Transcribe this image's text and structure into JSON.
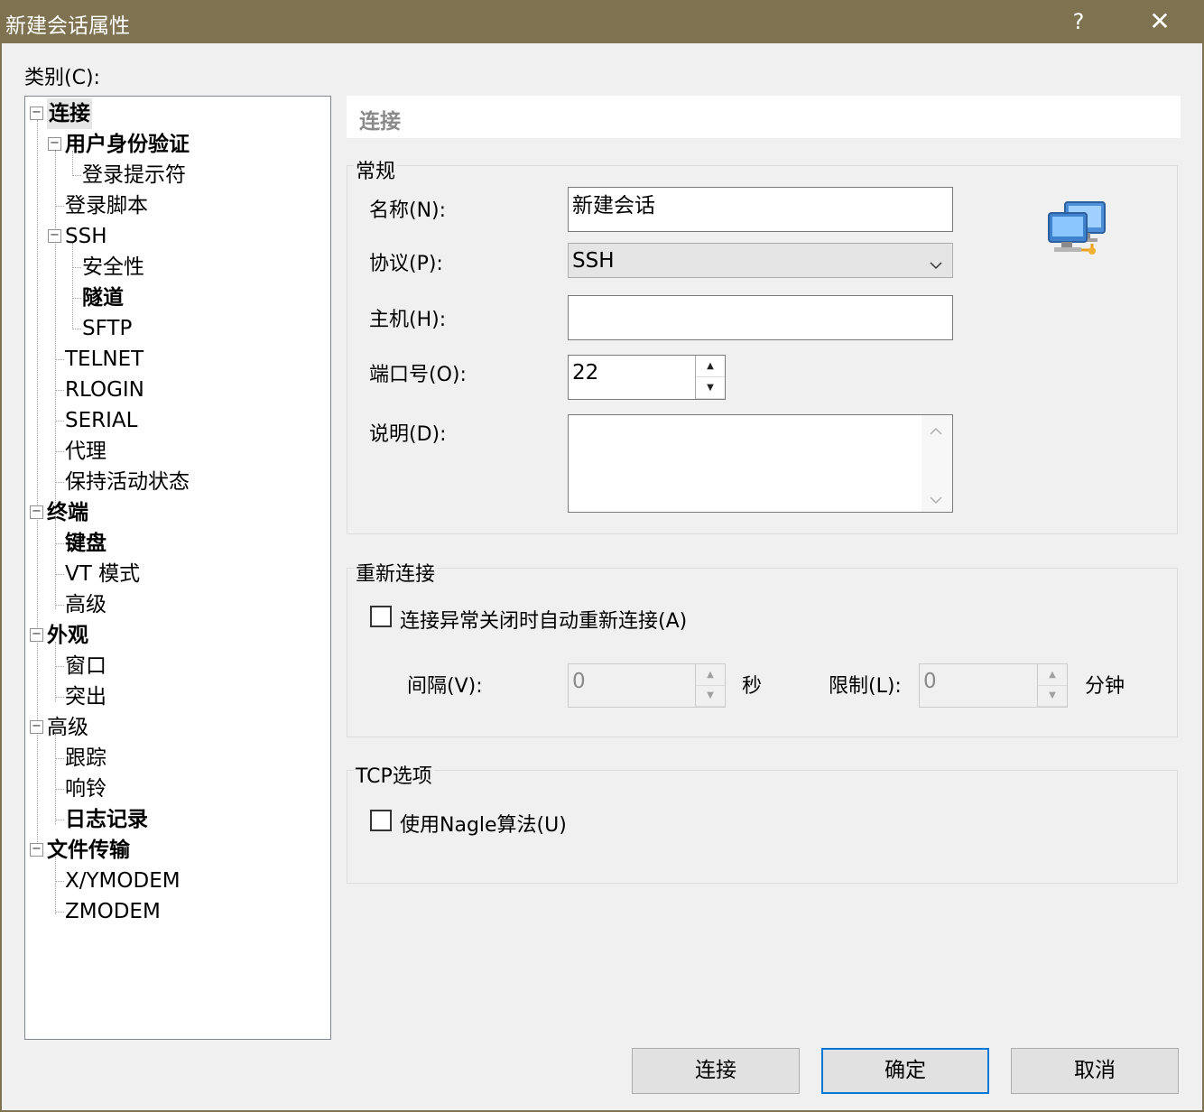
{
  "window": {
    "title": "新建会话属性",
    "help_label": "?",
    "close_label": "✕"
  },
  "category_label": "类别(C):",
  "tree": {
    "items": [
      {
        "label": "连接"
      },
      {
        "label": "用户身份验证"
      },
      {
        "label": "登录提示符"
      },
      {
        "label": "登录脚本"
      },
      {
        "label": "SSH"
      },
      {
        "label": "安全性"
      },
      {
        "label": "隧道"
      },
      {
        "label": "SFTP"
      },
      {
        "label": "TELNET"
      },
      {
        "label": "RLOGIN"
      },
      {
        "label": "SERIAL"
      },
      {
        "label": "代理"
      },
      {
        "label": "保持活动状态"
      },
      {
        "label": "终端"
      },
      {
        "label": "键盘"
      },
      {
        "label": "VT 模式"
      },
      {
        "label": "高级"
      },
      {
        "label": "外观"
      },
      {
        "label": "窗口"
      },
      {
        "label": "突出"
      },
      {
        "label": "高级"
      },
      {
        "label": "跟踪"
      },
      {
        "label": "响铃"
      },
      {
        "label": "日志记录"
      },
      {
        "label": "文件传输"
      },
      {
        "label": "X/YMODEM"
      },
      {
        "label": "ZMODEM"
      }
    ],
    "expand_glyph": "−"
  },
  "panel": {
    "header": "连接",
    "general": {
      "title": "常规",
      "name_label": "名称(N):",
      "name_value": "新建会话",
      "protocol_label": "协议(P):",
      "protocol_value": "SSH",
      "host_label": "主机(H):",
      "host_value": "",
      "port_label": "端口号(O):",
      "port_value": "22",
      "desc_label": "说明(D):",
      "desc_value": ""
    },
    "reconnect": {
      "title": "重新连接",
      "auto_reconnect_label": "连接异常关闭时自动重新连接(A)",
      "interval_label": "间隔(V):",
      "interval_value": "0",
      "interval_unit": "秒",
      "limit_label": "限制(L):",
      "limit_value": "0",
      "limit_unit": "分钟"
    },
    "tcp": {
      "title": "TCP选项",
      "nagle_label": "使用Nagle算法(U)"
    }
  },
  "buttons": {
    "connect": "连接",
    "ok": "确定",
    "cancel": "取消"
  }
}
